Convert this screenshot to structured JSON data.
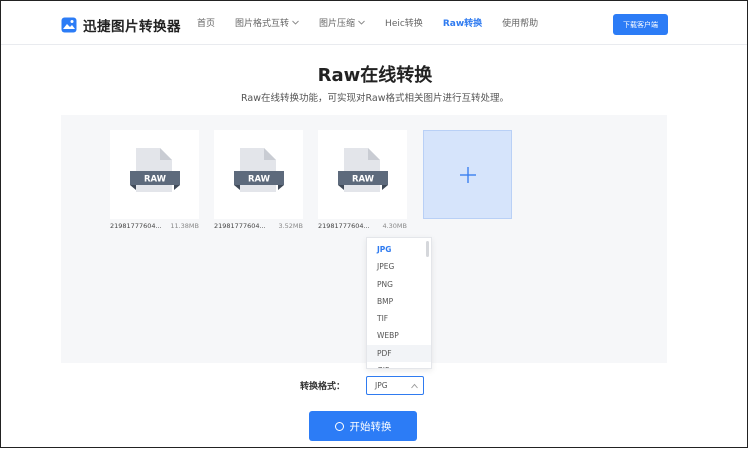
{
  "header": {
    "logo_text": "迅捷图片转换器",
    "nav": [
      {
        "label": "首页",
        "dropdown": false,
        "active": false
      },
      {
        "label": "图片格式互转",
        "dropdown": true,
        "active": false
      },
      {
        "label": "图片压缩",
        "dropdown": true,
        "active": false
      },
      {
        "label": "Heic转换",
        "dropdown": false,
        "active": false
      },
      {
        "label": "Raw转换",
        "dropdown": false,
        "active": true
      },
      {
        "label": "使用帮助",
        "dropdown": false,
        "active": false
      }
    ],
    "download_label": "下载客户端"
  },
  "page": {
    "title": "Raw在线转换",
    "subtitle": "Raw在线转换功能，可实现对Raw格式相关图片进行互转处理。"
  },
  "files": [
    {
      "badge": "RAW",
      "name": "21981777604...",
      "size": "11.38MB"
    },
    {
      "badge": "RAW",
      "name": "21981777604...",
      "size": "3.52MB"
    },
    {
      "badge": "RAW",
      "name": "21981777604...",
      "size": "4.30MB"
    }
  ],
  "dropdown": {
    "options": [
      "JPG",
      "JPEG",
      "PNG",
      "BMP",
      "TIF",
      "WEBP",
      "PDF",
      "GIF"
    ],
    "selected": "JPG",
    "hovered": "PDF"
  },
  "format": {
    "label": "转换格式：",
    "value": "JPG"
  },
  "start_button": {
    "label": "开始转换"
  },
  "colors": {
    "accent": "#2c7cf6",
    "add_card_bg": "#d6e4fb",
    "work_area_bg": "#f6f7f9"
  }
}
